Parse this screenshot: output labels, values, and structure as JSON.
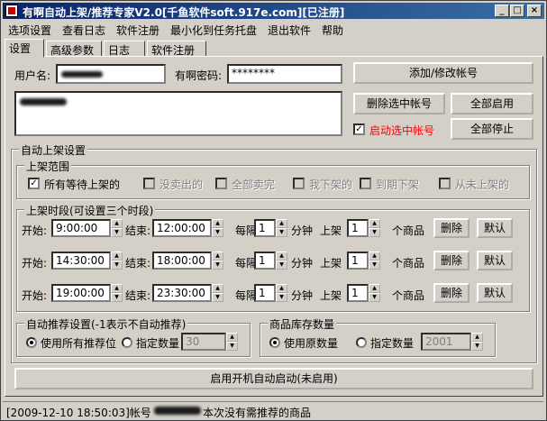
{
  "window": {
    "title": "有啊自动上架/推荐专家V2.0[千鱼软件soft.917e.com][已注册]"
  },
  "menu": [
    "选项设置",
    "查看日志",
    "软件注册",
    "最小化到任务托盘",
    "退出软件",
    "帮助"
  ],
  "tabs": [
    "设置",
    "高级参数",
    "日志",
    "软件注册"
  ],
  "account": {
    "username_label": "用户名:",
    "password_label": "有啊密码:",
    "password_value": "********"
  },
  "buttons": {
    "add_modify": "添加/修改帐号",
    "delete_selected": "删除选中帐号",
    "enable_all": "全部启用",
    "stop_all": "全部停止",
    "startup": "启用开机自动启动(未启用)"
  },
  "start_selected": {
    "label": "启动选中帐号",
    "checked": true,
    "color": "#ff0000"
  },
  "auto_list": {
    "title": "自动上架设置",
    "range": {
      "title": "上架范围",
      "options": [
        {
          "label": "所有等待上架的",
          "checked": true,
          "enabled": true
        },
        {
          "label": "没卖出的",
          "checked": false,
          "enabled": false
        },
        {
          "label": "全部卖完",
          "checked": false,
          "enabled": false
        },
        {
          "label": "我下架的",
          "checked": false,
          "enabled": false
        },
        {
          "label": "到期下架",
          "checked": false,
          "enabled": false
        },
        {
          "label": "从未上架的",
          "checked": false,
          "enabled": false
        }
      ]
    },
    "period": {
      "title": "上架时段(可设置三个时段)",
      "start_label": "开始:",
      "end_label": "结束:",
      "every_label": "每隔",
      "minute_label": "分钟",
      "list_label": "上架",
      "items_label": "个商品",
      "delete_label": "删除",
      "default_label": "默认",
      "rows": [
        {
          "start": "9:00:00",
          "end": "12:00:00",
          "interval": "1",
          "count": "1"
        },
        {
          "start": "14:30:00",
          "end": "18:00:00",
          "interval": "1",
          "count": "1"
        },
        {
          "start": "19:00:00",
          "end": "23:30:00",
          "interval": "1",
          "count": "1"
        }
      ]
    }
  },
  "recommend": {
    "title": "自动推荐设置(-1表示不自动推荐)",
    "opt_all": "使用所有推荐位",
    "opt_count": "指定数量",
    "count_value": "30",
    "selected": "all"
  },
  "stock": {
    "title": "商品库存数量",
    "opt_orig": "使用原数量",
    "opt_count": "指定数量",
    "count_value": "2001",
    "selected": "orig"
  },
  "status": {
    "prefix": "[2009-12-10 18:50:03]帐号",
    "suffix": "本次没有需推荐的商品"
  }
}
